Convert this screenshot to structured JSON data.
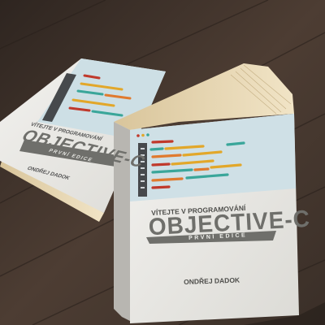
{
  "colors": {
    "table_wood": "#4a3a30",
    "cover_white": "#ecebe7",
    "code_panel_blue": "#cfe0e6",
    "title_gray": "#6f6f6b",
    "accent_red": "#c0392b",
    "accent_yellow": "#e2a72a",
    "accent_teal": "#3aa69a",
    "accent_orange": "#e07a2e",
    "pages_cream": "#e9d9b5"
  },
  "front_book": {
    "subtitle": "VÍTEJTE V PROGRAMOVÁNÍ",
    "title": "OBJECTIVE-C",
    "edition": "PRVNÍ EDICE",
    "author": "ONDŘEJ DADOK"
  },
  "back_book": {
    "subtitle": "VÍTEJTE V PROGRAMOVÁNÍ",
    "title": "OBJECTIVE-C",
    "edition": "PRVNÍ EDICE",
    "author": "ONDŘEJ DADOK"
  }
}
